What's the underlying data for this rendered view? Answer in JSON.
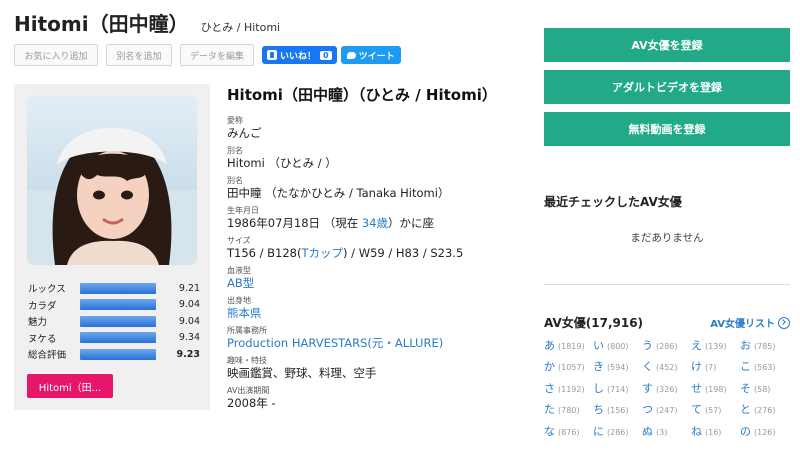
{
  "header": {
    "title": "Hitomi（田中瞳）",
    "subtitle": "ひとみ / Hitomi"
  },
  "actions": {
    "favorite": "お気に入り追加",
    "alias": "別名を追加",
    "edit": "データを編集",
    "like": "いいね！",
    "like_count": "0",
    "tweet": "ツイート"
  },
  "profile": {
    "stats": [
      {
        "label": "ルックス",
        "value": "9.21"
      },
      {
        "label": "カラダ",
        "value": "9.04"
      },
      {
        "label": "魅力",
        "value": "9.04"
      },
      {
        "label": "ヌケる",
        "value": "9.34"
      },
      {
        "label": "総合評価",
        "value": "9.23"
      }
    ],
    "name_button": "Hitomi（田..."
  },
  "info": {
    "title": "Hitomi（田中瞳）（ひとみ / Hitomi）",
    "nickname_label": "愛称",
    "nickname": "みんご",
    "alias1_label": "別名",
    "alias1": "Hitomi （ひとみ / ）",
    "alias2_label": "別名",
    "alias2": "田中瞳 （たなかひとみ / Tanaka Hitomi）",
    "birth_label": "生年月日",
    "birth_pre": "1986年07月18日 （現在 ",
    "birth_age": "34歳",
    "birth_post": "）かに座",
    "size_label": "サイズ",
    "size_pre": "T156 / B128(",
    "size_cup": "Tカップ",
    "size_post": ") / W59 / H83 / S23.5",
    "blood_label": "血液型",
    "blood": "AB型",
    "origin_label": "出身地",
    "origin": "熊本県",
    "agency_label": "所属事務所",
    "agency": "Production HARVESTARS(元・ALLURE)",
    "hobby_label": "趣味・特技",
    "hobby": "映画鑑賞、野球、料理、空手",
    "period_label": "AV出演期間",
    "period": "2008年 -"
  },
  "sidebar": {
    "btn1": "AV女優を登録",
    "btn2": "アダルトビデオを登録",
    "btn3": "無料動画を登録",
    "recent_title": "最近チェックしたAV女優",
    "recent_empty": "まだありません",
    "av_title": "AV女優(17,916)",
    "av_link": "AV女優リスト",
    "kana": [
      [
        {
          "c": "あ",
          "n": "(1819)"
        },
        {
          "c": "い",
          "n": "(800)"
        },
        {
          "c": "う",
          "n": "(286)"
        },
        {
          "c": "え",
          "n": "(139)"
        },
        {
          "c": "お",
          "n": "(785)"
        }
      ],
      [
        {
          "c": "か",
          "n": "(1057)"
        },
        {
          "c": "き",
          "n": "(594)"
        },
        {
          "c": "く",
          "n": "(452)"
        },
        {
          "c": "け",
          "n": "(7)"
        },
        {
          "c": "こ",
          "n": "(563)"
        }
      ],
      [
        {
          "c": "さ",
          "n": "(1192)"
        },
        {
          "c": "し",
          "n": "(714)"
        },
        {
          "c": "す",
          "n": "(326)"
        },
        {
          "c": "せ",
          "n": "(198)"
        },
        {
          "c": "そ",
          "n": "(58)"
        }
      ],
      [
        {
          "c": "た",
          "n": "(780)"
        },
        {
          "c": "ち",
          "n": "(156)"
        },
        {
          "c": "つ",
          "n": "(247)"
        },
        {
          "c": "て",
          "n": "(57)"
        },
        {
          "c": "と",
          "n": "(276)"
        }
      ],
      [
        {
          "c": "な",
          "n": "(876)"
        },
        {
          "c": "に",
          "n": "(286)"
        },
        {
          "c": "ぬ",
          "n": "(3)"
        },
        {
          "c": "ね",
          "n": "(16)"
        },
        {
          "c": "の",
          "n": "(126)"
        }
      ]
    ]
  }
}
